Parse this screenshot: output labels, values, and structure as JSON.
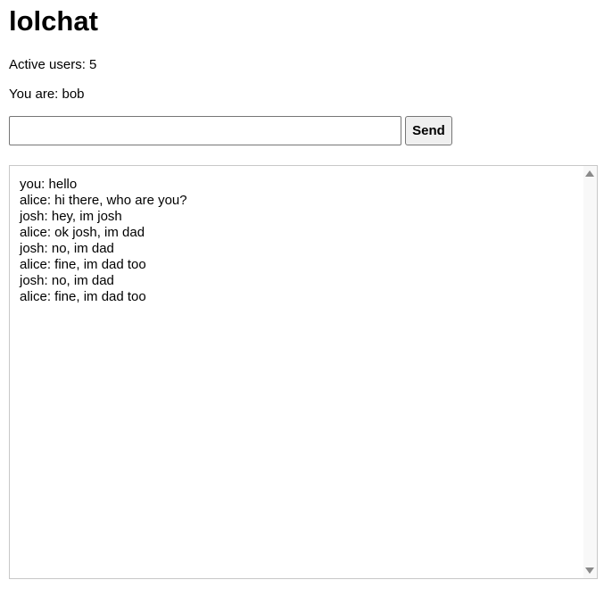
{
  "app": {
    "title": "lolchat"
  },
  "status": {
    "active_users": "Active users: 5",
    "you_are": "You are: bob"
  },
  "composer": {
    "input_value": "",
    "input_placeholder": "",
    "send_label": "Send"
  },
  "chat": {
    "messages": [
      "you: hello",
      "alice: hi there, who are you?",
      "josh: hey, im josh",
      "alice: ok josh, im dad",
      "josh: no, im dad",
      "alice: fine, im dad too",
      "josh: no, im dad",
      "alice: fine, im dad too"
    ]
  },
  "icons": {
    "scroll_up": "scroll-up-arrow-icon",
    "scroll_down": "scroll-down-arrow-icon"
  }
}
